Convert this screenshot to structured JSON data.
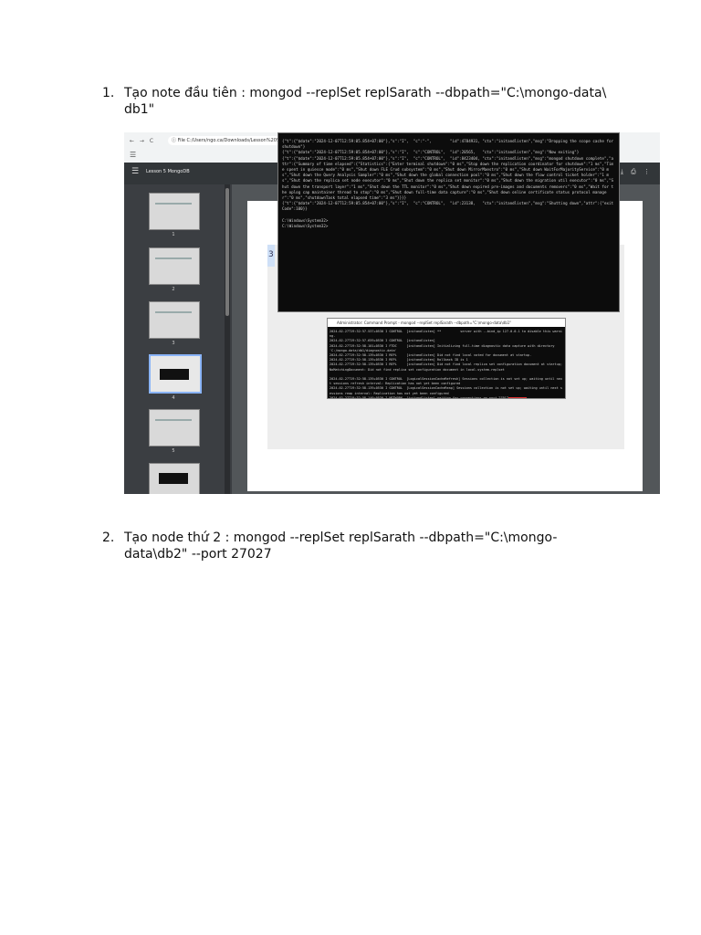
{
  "steps": [
    {
      "number": "1.",
      "text": "Tạo note đầu tiên : mongod --replSet replSarath --dbpath=\"C:\\mongo-data\\ db1\""
    },
    {
      "number": "2.",
      "text": "Tạo node thứ 2 : mongod --replSet replSarath --dbpath=\"C:\\mongo-data\\db2\" --port 27027"
    }
  ],
  "screenshot": {
    "browser": {
      "nav_icons": "← → C",
      "url": "ⓘ File  C:/Users/ngo.ca/Downloads/Lesson%205",
      "menu": "☰"
    },
    "pdf_toolbar": {
      "menu": "☰",
      "title": "Lesson 5 MongoDB",
      "tools": "⤓ ⎙ ⋮"
    },
    "thumbnails": [
      {
        "label": "1"
      },
      {
        "label": "2"
      },
      {
        "label": "3"
      },
      {
        "label": "4"
      },
      {
        "label": "5"
      },
      {
        "label": ""
      }
    ],
    "page_marker": "3",
    "cmd_big_log": "{\"t\":{\"$date\":\"2024-12-07T12:59:05.854+07:00\"},\"s\":\"I\",  \"c\":\"-\",        \"id\":4784931, \"ctx\":\"initandlisten\",\"msg\":\"Dropping the scope cache for shutdown\"}\n{\"t\":{\"$date\":\"2024-12-07T12:59:05.854+07:00\"},\"s\":\"I\",  \"c\":\"CONTROL\",  \"id\":20565,   \"ctx\":\"initandlisten\",\"msg\":\"Now exiting\"}\n{\"t\":{\"$date\":\"2024-12-07T12:59:05.854+07:00\"},\"s\":\"I\",  \"c\":\"CONTROL\",  \"id\":8423404, \"ctx\":\"initandlisten\",\"msg\":\"mongod shutdown complete\",\"attr\":{\"Summary of time elapsed\":{\"Statistics\":{\"Enter terminal shutdown\":\"0 ms\",\"Stop down the replication coordinator for shutdown\":\"1 ms\",\"Time spent in quiesce mode\":\"0 ms\",\"Shut down FLE Crud subsystem\":\"0 ms\",\"Shut down MirrorMaestro\":\"0 ms\",\"Shut down WaitForMajorityService\":\"0 ms\",\"Shut down the Query Analysis Sampler\":\"0 ms\",\"Shut down the global connection pool\":\"0 ms\",\"Shut down the flow control ticket holder\":\"1 ms\",\"Shut down the replica set node executor\":\"0 ms\",\"Shut down the replica set monitor\":\"0 ms\",\"Shut down the migration util executor\":\"0 ms\",\"Shut down the transport layer\":\"1 ms\",\"Shut down the TTL monitor\":\"0 ms\",\"Shut down expired pre-images and documents removers\":\"0 ms\",\"Wait for the oplog cap maintainer thread to stop\":\"0 ms\",\"Shut down full-time data capture\":\"0 ms\",\"Shut down online certificate status protocol manager\":\"0 ms\",\"shutdownTask total elapsed time\":\"3 ms\"}}}}\n{\"t\":{\"$date\":\"2024-12-07T12:59:05.854+07:00\"},\"s\":\"I\",  \"c\":\"CONTROL\",  \"id\":23138,   \"ctx\":\"initandlisten\",\"msg\":\"Shutting down\",\"attr\":{\"exitCode\":100}}\n\nC:\\Windows\\System32>\nC:\\Windows\\System32>",
    "cmd_small_title": "Administrator: Command Prompt - mongod --replSet replSarath --dbpath=\"C:\\mongo-data\\db1\"",
    "cmd_small_log": "2024-02-27T19:32:57.537+0530 I CONTROL  [initandlisten] **          server with --bind_ip 127.0.0.1 to disable this warning.\n2024-02-27T19:32:57.659+0530 I CONTROL  [initandlisten]\n2024-02-27T19:32:58.101+0530 I FTDC     [initandlisten] Initializing full-time diagnostic data capture with directory 'C:/mongo-data/db1/diagnostic.data'\n2024-02-27T19:32:58.139+0530 I REPL     [initandlisten] Did not find local voted for document at startup.\n2024-02-27T19:32:58.139+0530 I REPL     [initandlisten] Rollback ID is 1\n2024-02-27T19:32:58.139+0530 I REPL     [initandlisten] Did not find local replica set configuration document at startup;  NoMatchingDocument: Did not find replica set configuration document in local.system.replset\n\n2024-02-27T19:32:58.139+0530 I CONTROL  [LogicalSessionCacheRefresh] Sessions collection is not set up; waiting until next sessions refresh interval: Replication has not yet been configured\n2024-02-27T19:32:58.139+0530 I CONTROL  [LogicalSessionCacheReap] Sessions collection is not set up; waiting until next sessions reap interval: Replication has not yet been configured\n2024-02-27T19:32:58.140+0530 I NETWORK  [initandlisten] waiting for connections on port 27017"
  }
}
